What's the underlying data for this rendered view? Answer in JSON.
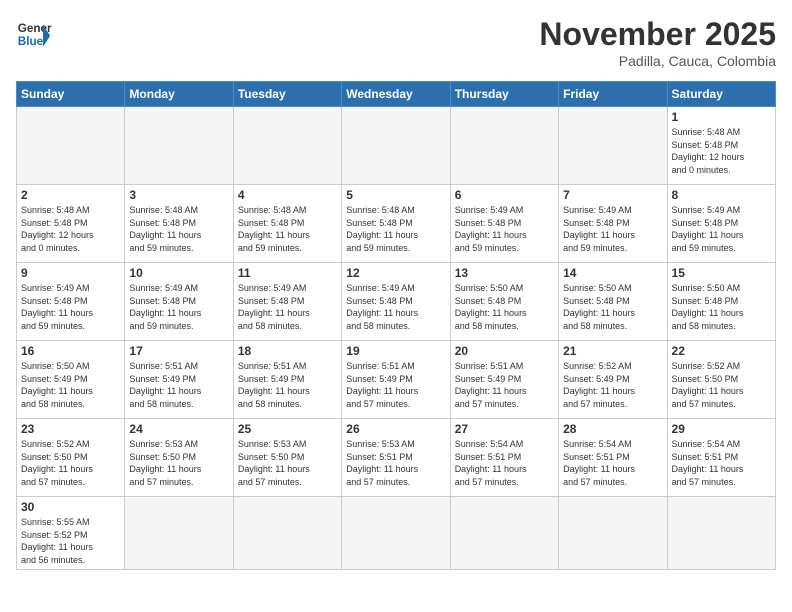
{
  "header": {
    "logo_general": "General",
    "logo_blue": "Blue",
    "month_title": "November 2025",
    "subtitle": "Padilla, Cauca, Colombia"
  },
  "days_of_week": [
    "Sunday",
    "Monday",
    "Tuesday",
    "Wednesday",
    "Thursday",
    "Friday",
    "Saturday"
  ],
  "weeks": [
    [
      {
        "day": "",
        "info": ""
      },
      {
        "day": "",
        "info": ""
      },
      {
        "day": "",
        "info": ""
      },
      {
        "day": "",
        "info": ""
      },
      {
        "day": "",
        "info": ""
      },
      {
        "day": "",
        "info": ""
      },
      {
        "day": "1",
        "info": "Sunrise: 5:48 AM\nSunset: 5:48 PM\nDaylight: 12 hours\nand 0 minutes."
      }
    ],
    [
      {
        "day": "2",
        "info": "Sunrise: 5:48 AM\nSunset: 5:48 PM\nDaylight: 12 hours\nand 0 minutes."
      },
      {
        "day": "3",
        "info": "Sunrise: 5:48 AM\nSunset: 5:48 PM\nDaylight: 11 hours\nand 59 minutes."
      },
      {
        "day": "4",
        "info": "Sunrise: 5:48 AM\nSunset: 5:48 PM\nDaylight: 11 hours\nand 59 minutes."
      },
      {
        "day": "5",
        "info": "Sunrise: 5:48 AM\nSunset: 5:48 PM\nDaylight: 11 hours\nand 59 minutes."
      },
      {
        "day": "6",
        "info": "Sunrise: 5:49 AM\nSunset: 5:48 PM\nDaylight: 11 hours\nand 59 minutes."
      },
      {
        "day": "7",
        "info": "Sunrise: 5:49 AM\nSunset: 5:48 PM\nDaylight: 11 hours\nand 59 minutes."
      },
      {
        "day": "8",
        "info": "Sunrise: 5:49 AM\nSunset: 5:48 PM\nDaylight: 11 hours\nand 59 minutes."
      }
    ],
    [
      {
        "day": "9",
        "info": "Sunrise: 5:49 AM\nSunset: 5:48 PM\nDaylight: 11 hours\nand 59 minutes."
      },
      {
        "day": "10",
        "info": "Sunrise: 5:49 AM\nSunset: 5:48 PM\nDaylight: 11 hours\nand 59 minutes."
      },
      {
        "day": "11",
        "info": "Sunrise: 5:49 AM\nSunset: 5:48 PM\nDaylight: 11 hours\nand 58 minutes."
      },
      {
        "day": "12",
        "info": "Sunrise: 5:49 AM\nSunset: 5:48 PM\nDaylight: 11 hours\nand 58 minutes."
      },
      {
        "day": "13",
        "info": "Sunrise: 5:50 AM\nSunset: 5:48 PM\nDaylight: 11 hours\nand 58 minutes."
      },
      {
        "day": "14",
        "info": "Sunrise: 5:50 AM\nSunset: 5:48 PM\nDaylight: 11 hours\nand 58 minutes."
      },
      {
        "day": "15",
        "info": "Sunrise: 5:50 AM\nSunset: 5:48 PM\nDaylight: 11 hours\nand 58 minutes."
      }
    ],
    [
      {
        "day": "16",
        "info": "Sunrise: 5:50 AM\nSunset: 5:49 PM\nDaylight: 11 hours\nand 58 minutes."
      },
      {
        "day": "17",
        "info": "Sunrise: 5:51 AM\nSunset: 5:49 PM\nDaylight: 11 hours\nand 58 minutes."
      },
      {
        "day": "18",
        "info": "Sunrise: 5:51 AM\nSunset: 5:49 PM\nDaylight: 11 hours\nand 58 minutes."
      },
      {
        "day": "19",
        "info": "Sunrise: 5:51 AM\nSunset: 5:49 PM\nDaylight: 11 hours\nand 57 minutes."
      },
      {
        "day": "20",
        "info": "Sunrise: 5:51 AM\nSunset: 5:49 PM\nDaylight: 11 hours\nand 57 minutes."
      },
      {
        "day": "21",
        "info": "Sunrise: 5:52 AM\nSunset: 5:49 PM\nDaylight: 11 hours\nand 57 minutes."
      },
      {
        "day": "22",
        "info": "Sunrise: 5:52 AM\nSunset: 5:50 PM\nDaylight: 11 hours\nand 57 minutes."
      }
    ],
    [
      {
        "day": "23",
        "info": "Sunrise: 5:52 AM\nSunset: 5:50 PM\nDaylight: 11 hours\nand 57 minutes."
      },
      {
        "day": "24",
        "info": "Sunrise: 5:53 AM\nSunset: 5:50 PM\nDaylight: 11 hours\nand 57 minutes."
      },
      {
        "day": "25",
        "info": "Sunrise: 5:53 AM\nSunset: 5:50 PM\nDaylight: 11 hours\nand 57 minutes."
      },
      {
        "day": "26",
        "info": "Sunrise: 5:53 AM\nSunset: 5:51 PM\nDaylight: 11 hours\nand 57 minutes."
      },
      {
        "day": "27",
        "info": "Sunrise: 5:54 AM\nSunset: 5:51 PM\nDaylight: 11 hours\nand 57 minutes."
      },
      {
        "day": "28",
        "info": "Sunrise: 5:54 AM\nSunset: 5:51 PM\nDaylight: 11 hours\nand 57 minutes."
      },
      {
        "day": "29",
        "info": "Sunrise: 5:54 AM\nSunset: 5:51 PM\nDaylight: 11 hours\nand 57 minutes."
      }
    ],
    [
      {
        "day": "30",
        "info": "Sunrise: 5:55 AM\nSunset: 5:52 PM\nDaylight: 11 hours\nand 56 minutes."
      },
      {
        "day": "",
        "info": ""
      },
      {
        "day": "",
        "info": ""
      },
      {
        "day": "",
        "info": ""
      },
      {
        "day": "",
        "info": ""
      },
      {
        "day": "",
        "info": ""
      },
      {
        "day": "",
        "info": ""
      }
    ]
  ]
}
